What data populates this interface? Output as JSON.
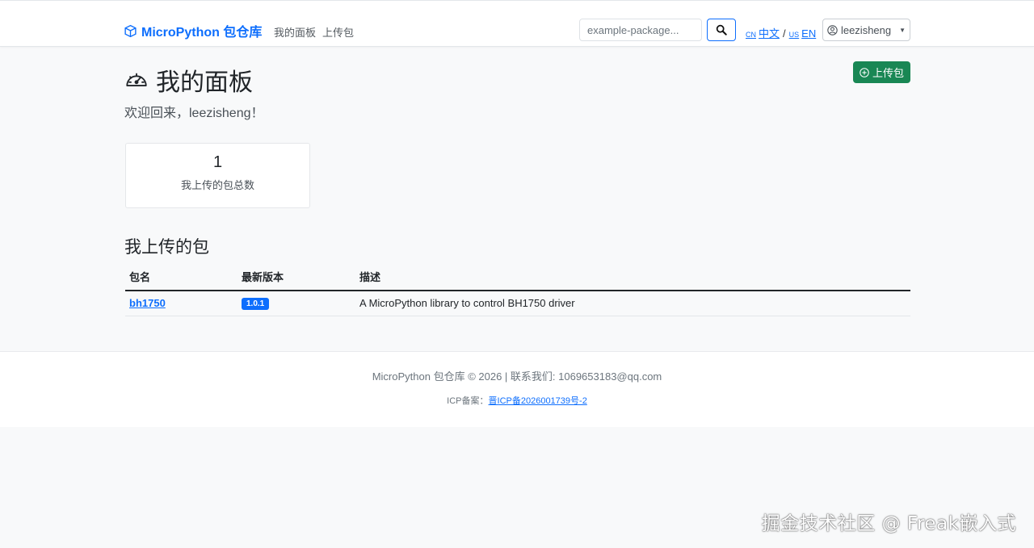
{
  "navbar": {
    "brand": "MicroPython 包仓库",
    "links": [
      "我的面板",
      "上传包"
    ],
    "search_placeholder": "example-package...",
    "lang": {
      "cn_flag": "CN",
      "cn_label": "中文",
      "separator": "/",
      "us_flag": "US",
      "en_label": "EN"
    },
    "user": "leezisheng"
  },
  "dashboard": {
    "title": "我的面板",
    "upload_button": "上传包",
    "welcome": "欢迎回来，leezisheng！",
    "stat": {
      "value": "1",
      "label": "我上传的包总数"
    }
  },
  "packages": {
    "title": "我上传的包",
    "headers": [
      "包名",
      "最新版本",
      "描述"
    ],
    "rows": [
      {
        "name": "bh1750",
        "version": "1.0.1",
        "description": "A MicroPython library to control BH1750 driver"
      }
    ]
  },
  "footer": {
    "line1": "MicroPython 包仓库 © 2026 | 联系我们: 1069653183@qq.com",
    "icp_label": "ICP备案：",
    "icp_link": "晋ICP备2026001739号-2"
  },
  "watermark": "掘金技术社区 @ Freak嵌入式",
  "colors": {
    "primary": "#0d6efd",
    "success": "#198754"
  }
}
